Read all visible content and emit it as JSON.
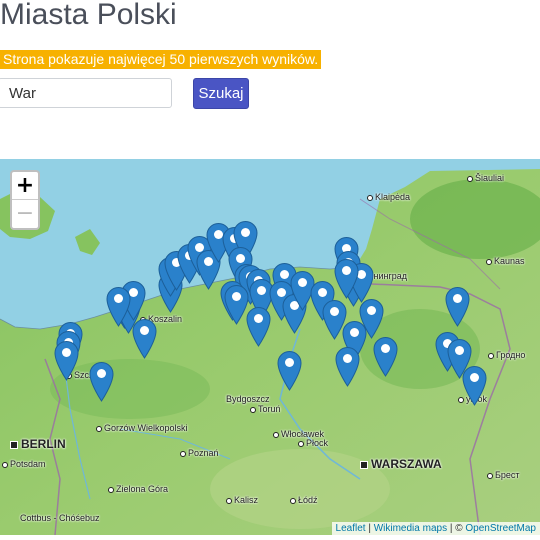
{
  "page": {
    "title": "Miasta Polski",
    "notice": "Strona pokazuje najwięcej 50 pierwszych wyników.",
    "search_value": "War",
    "search_button": "Szukaj"
  },
  "map": {
    "zoom_in": "+",
    "zoom_out": "−",
    "attribution": {
      "leaflet": "Leaflet",
      "sep1": " | ",
      "wikimedia": "Wikimedia maps",
      "sep2": " | © ",
      "osm": "OpenStreetMap"
    },
    "labels": {
      "klaipeda": "Klaipėda",
      "siauliai": "Šiauliai",
      "kaunas": "Kaunas",
      "kaliningrad": "Калининград",
      "koszalin": "Koszalin",
      "szczecin": "Szcz",
      "grodno": "Гродно",
      "bialystok": "ystok",
      "bydgoszcz": "Bydgoszcz",
      "torun": "Toruń",
      "gorzow": "Gorzów Wielkopolski",
      "berlin": "BERLIN",
      "potsdam": "Potsdam",
      "poznan": "Poznań",
      "wloclawek": "Włocławek",
      "plock": "Płock",
      "warszawa": "WARSZAWA",
      "brest": "Брест",
      "zielona_gora": "Zielona Góra",
      "kalisz": "Kalisz",
      "lodz": "Łódź",
      "cottbus": "Cottbus - Chóśebuz"
    },
    "marker_color": "#2a81cb",
    "sea_color": "#92d0e4",
    "land_color": "#8cc66a"
  }
}
